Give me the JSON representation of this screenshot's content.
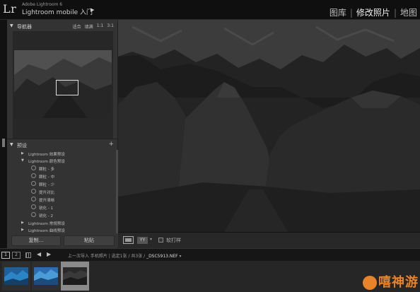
{
  "app": {
    "logo": "Lr",
    "product_line1": "Adobe Lightroom 6",
    "product_line2": "Lightroom mobile 入门",
    "play_glyph": "▶"
  },
  "modules": [
    {
      "label": "图库",
      "active": false
    },
    {
      "label": "修改照片",
      "active": true
    },
    {
      "label": "地图",
      "active": false
    }
  ],
  "navigator": {
    "title": "导航器",
    "zoom_levels": [
      "适合",
      "填满",
      "1:1",
      "3:1"
    ]
  },
  "presets": {
    "title": "预设",
    "add_glyph": "+",
    "items": [
      {
        "label": "Lightroom 效果预设",
        "level": 0,
        "expanded": false
      },
      {
        "label": "Lightroom 颜色预设",
        "level": 0,
        "expanded": true
      },
      {
        "label": "颗粒 - 多",
        "level": 1
      },
      {
        "label": "颗粒 - 中",
        "level": 1
      },
      {
        "label": "颗粒 - 少",
        "level": 1
      },
      {
        "label": "提升对比",
        "level": 1
      },
      {
        "label": "提升清晰",
        "level": 1
      },
      {
        "label": "锐化 - 1",
        "level": 1
      },
      {
        "label": "锐化 - 2",
        "level": 1
      },
      {
        "label": "Lightroom 常规预设",
        "level": 0,
        "expanded": false
      },
      {
        "label": "Lightroom 曲线预设",
        "level": 0,
        "expanded": false
      }
    ]
  },
  "buttons": {
    "copy": "复制...",
    "paste": "粘贴"
  },
  "toolbar": {
    "view_badge": "YY",
    "dropdown_glyph": "▾",
    "softproof_label": "软打样"
  },
  "filmstrip_header": {
    "num1": "1",
    "num2": "2",
    "prev_glyph": "◀",
    "next_glyph": "▶",
    "path_prefix": "上一次导入  手机照片 | 选定1张 / 共3张 / ",
    "filename": "_DSC5913.NEF",
    "path_suffix": " ▾"
  },
  "watermark": {
    "text": "嘻神游"
  },
  "colors": {
    "accent_orange": "#e8832a",
    "panel": "#333333",
    "background": "#1a1a1a"
  }
}
